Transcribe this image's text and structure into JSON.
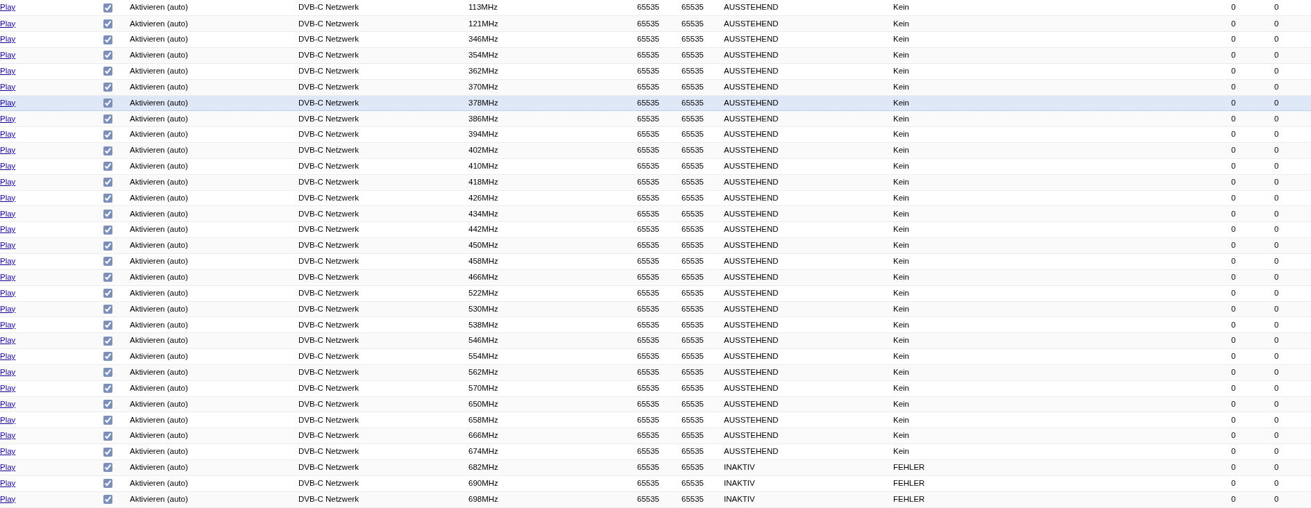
{
  "rows": [
    {
      "link": "Play",
      "enabled": true,
      "mode": "Aktivieren (auto)",
      "network": "DVB-C Netzwerk",
      "frequency": "113MHz",
      "column_6": "65535",
      "column_7": "65535",
      "status": "AUSSTEHEND",
      "result": "Kein",
      "column_10": "0",
      "column_11": "0",
      "selected": false
    },
    {
      "link": "Play",
      "enabled": true,
      "mode": "Aktivieren (auto)",
      "network": "DVB-C Netzwerk",
      "frequency": "121MHz",
      "column_6": "65535",
      "column_7": "65535",
      "status": "AUSSTEHEND",
      "result": "Kein",
      "column_10": "0",
      "column_11": "0",
      "selected": false
    },
    {
      "link": "Play",
      "enabled": true,
      "mode": "Aktivieren (auto)",
      "network": "DVB-C Netzwerk",
      "frequency": "346MHz",
      "column_6": "65535",
      "column_7": "65535",
      "status": "AUSSTEHEND",
      "result": "Kein",
      "column_10": "0",
      "column_11": "0",
      "selected": false
    },
    {
      "link": "Play",
      "enabled": true,
      "mode": "Aktivieren (auto)",
      "network": "DVB-C Netzwerk",
      "frequency": "354MHz",
      "column_6": "65535",
      "column_7": "65535",
      "status": "AUSSTEHEND",
      "result": "Kein",
      "column_10": "0",
      "column_11": "0",
      "selected": false
    },
    {
      "link": "Play",
      "enabled": true,
      "mode": "Aktivieren (auto)",
      "network": "DVB-C Netzwerk",
      "frequency": "362MHz",
      "column_6": "65535",
      "column_7": "65535",
      "status": "AUSSTEHEND",
      "result": "Kein",
      "column_10": "0",
      "column_11": "0",
      "selected": false
    },
    {
      "link": "Play",
      "enabled": true,
      "mode": "Aktivieren (auto)",
      "network": "DVB-C Netzwerk",
      "frequency": "370MHz",
      "column_6": "65535",
      "column_7": "65535",
      "status": "AUSSTEHEND",
      "result": "Kein",
      "column_10": "0",
      "column_11": "0",
      "selected": false
    },
    {
      "link": "Play",
      "enabled": true,
      "mode": "Aktivieren (auto)",
      "network": "DVB-C Netzwerk",
      "frequency": "378MHz",
      "column_6": "65535",
      "column_7": "65535",
      "status": "AUSSTEHEND",
      "result": "Kein",
      "column_10": "0",
      "column_11": "0",
      "selected": true
    },
    {
      "link": "Play",
      "enabled": true,
      "mode": "Aktivieren (auto)",
      "network": "DVB-C Netzwerk",
      "frequency": "386MHz",
      "column_6": "65535",
      "column_7": "65535",
      "status": "AUSSTEHEND",
      "result": "Kein",
      "column_10": "0",
      "column_11": "0",
      "selected": false
    },
    {
      "link": "Play",
      "enabled": true,
      "mode": "Aktivieren (auto)",
      "network": "DVB-C Netzwerk",
      "frequency": "394MHz",
      "column_6": "65535",
      "column_7": "65535",
      "status": "AUSSTEHEND",
      "result": "Kein",
      "column_10": "0",
      "column_11": "0",
      "selected": false
    },
    {
      "link": "Play",
      "enabled": true,
      "mode": "Aktivieren (auto)",
      "network": "DVB-C Netzwerk",
      "frequency": "402MHz",
      "column_6": "65535",
      "column_7": "65535",
      "status": "AUSSTEHEND",
      "result": "Kein",
      "column_10": "0",
      "column_11": "0",
      "selected": false
    },
    {
      "link": "Play",
      "enabled": true,
      "mode": "Aktivieren (auto)",
      "network": "DVB-C Netzwerk",
      "frequency": "410MHz",
      "column_6": "65535",
      "column_7": "65535",
      "status": "AUSSTEHEND",
      "result": "Kein",
      "column_10": "0",
      "column_11": "0",
      "selected": false
    },
    {
      "link": "Play",
      "enabled": true,
      "mode": "Aktivieren (auto)",
      "network": "DVB-C Netzwerk",
      "frequency": "418MHz",
      "column_6": "65535",
      "column_7": "65535",
      "status": "AUSSTEHEND",
      "result": "Kein",
      "column_10": "0",
      "column_11": "0",
      "selected": false
    },
    {
      "link": "Play",
      "enabled": true,
      "mode": "Aktivieren (auto)",
      "network": "DVB-C Netzwerk",
      "frequency": "426MHz",
      "column_6": "65535",
      "column_7": "65535",
      "status": "AUSSTEHEND",
      "result": "Kein",
      "column_10": "0",
      "column_11": "0",
      "selected": false
    },
    {
      "link": "Play",
      "enabled": true,
      "mode": "Aktivieren (auto)",
      "network": "DVB-C Netzwerk",
      "frequency": "434MHz",
      "column_6": "65535",
      "column_7": "65535",
      "status": "AUSSTEHEND",
      "result": "Kein",
      "column_10": "0",
      "column_11": "0",
      "selected": false
    },
    {
      "link": "Play",
      "enabled": true,
      "mode": "Aktivieren (auto)",
      "network": "DVB-C Netzwerk",
      "frequency": "442MHz",
      "column_6": "65535",
      "column_7": "65535",
      "status": "AUSSTEHEND",
      "result": "Kein",
      "column_10": "0",
      "column_11": "0",
      "selected": false
    },
    {
      "link": "Play",
      "enabled": true,
      "mode": "Aktivieren (auto)",
      "network": "DVB-C Netzwerk",
      "frequency": "450MHz",
      "column_6": "65535",
      "column_7": "65535",
      "status": "AUSSTEHEND",
      "result": "Kein",
      "column_10": "0",
      "column_11": "0",
      "selected": false
    },
    {
      "link": "Play",
      "enabled": true,
      "mode": "Aktivieren (auto)",
      "network": "DVB-C Netzwerk",
      "frequency": "458MHz",
      "column_6": "65535",
      "column_7": "65535",
      "status": "AUSSTEHEND",
      "result": "Kein",
      "column_10": "0",
      "column_11": "0",
      "selected": false
    },
    {
      "link": "Play",
      "enabled": true,
      "mode": "Aktivieren (auto)",
      "network": "DVB-C Netzwerk",
      "frequency": "466MHz",
      "column_6": "65535",
      "column_7": "65535",
      "status": "AUSSTEHEND",
      "result": "Kein",
      "column_10": "0",
      "column_11": "0",
      "selected": false
    },
    {
      "link": "Play",
      "enabled": true,
      "mode": "Aktivieren (auto)",
      "network": "DVB-C Netzwerk",
      "frequency": "522MHz",
      "column_6": "65535",
      "column_7": "65535",
      "status": "AUSSTEHEND",
      "result": "Kein",
      "column_10": "0",
      "column_11": "0",
      "selected": false
    },
    {
      "link": "Play",
      "enabled": true,
      "mode": "Aktivieren (auto)",
      "network": "DVB-C Netzwerk",
      "frequency": "530MHz",
      "column_6": "65535",
      "column_7": "65535",
      "status": "AUSSTEHEND",
      "result": "Kein",
      "column_10": "0",
      "column_11": "0",
      "selected": false
    },
    {
      "link": "Play",
      "enabled": true,
      "mode": "Aktivieren (auto)",
      "network": "DVB-C Netzwerk",
      "frequency": "538MHz",
      "column_6": "65535",
      "column_7": "65535",
      "status": "AUSSTEHEND",
      "result": "Kein",
      "column_10": "0",
      "column_11": "0",
      "selected": false
    },
    {
      "link": "Play",
      "enabled": true,
      "mode": "Aktivieren (auto)",
      "network": "DVB-C Netzwerk",
      "frequency": "546MHz",
      "column_6": "65535",
      "column_7": "65535",
      "status": "AUSSTEHEND",
      "result": "Kein",
      "column_10": "0",
      "column_11": "0",
      "selected": false
    },
    {
      "link": "Play",
      "enabled": true,
      "mode": "Aktivieren (auto)",
      "network": "DVB-C Netzwerk",
      "frequency": "554MHz",
      "column_6": "65535",
      "column_7": "65535",
      "status": "AUSSTEHEND",
      "result": "Kein",
      "column_10": "0",
      "column_11": "0",
      "selected": false
    },
    {
      "link": "Play",
      "enabled": true,
      "mode": "Aktivieren (auto)",
      "network": "DVB-C Netzwerk",
      "frequency": "562MHz",
      "column_6": "65535",
      "column_7": "65535",
      "status": "AUSSTEHEND",
      "result": "Kein",
      "column_10": "0",
      "column_11": "0",
      "selected": false
    },
    {
      "link": "Play",
      "enabled": true,
      "mode": "Aktivieren (auto)",
      "network": "DVB-C Netzwerk",
      "frequency": "570MHz",
      "column_6": "65535",
      "column_7": "65535",
      "status": "AUSSTEHEND",
      "result": "Kein",
      "column_10": "0",
      "column_11": "0",
      "selected": false
    },
    {
      "link": "Play",
      "enabled": true,
      "mode": "Aktivieren (auto)",
      "network": "DVB-C Netzwerk",
      "frequency": "650MHz",
      "column_6": "65535",
      "column_7": "65535",
      "status": "AUSSTEHEND",
      "result": "Kein",
      "column_10": "0",
      "column_11": "0",
      "selected": false
    },
    {
      "link": "Play",
      "enabled": true,
      "mode": "Aktivieren (auto)",
      "network": "DVB-C Netzwerk",
      "frequency": "658MHz",
      "column_6": "65535",
      "column_7": "65535",
      "status": "AUSSTEHEND",
      "result": "Kein",
      "column_10": "0",
      "column_11": "0",
      "selected": false
    },
    {
      "link": "Play",
      "enabled": true,
      "mode": "Aktivieren (auto)",
      "network": "DVB-C Netzwerk",
      "frequency": "666MHz",
      "column_6": "65535",
      "column_7": "65535",
      "status": "AUSSTEHEND",
      "result": "Kein",
      "column_10": "0",
      "column_11": "0",
      "selected": false
    },
    {
      "link": "Play",
      "enabled": true,
      "mode": "Aktivieren (auto)",
      "network": "DVB-C Netzwerk",
      "frequency": "674MHz",
      "column_6": "65535",
      "column_7": "65535",
      "status": "AUSSTEHEND",
      "result": "Kein",
      "column_10": "0",
      "column_11": "0",
      "selected": false
    },
    {
      "link": "Play",
      "enabled": true,
      "mode": "Aktivieren (auto)",
      "network": "DVB-C Netzwerk",
      "frequency": "682MHz",
      "column_6": "65535",
      "column_7": "65535",
      "status": "INAKTIV",
      "result": "FEHLER",
      "column_10": "0",
      "column_11": "0",
      "selected": false
    },
    {
      "link": "Play",
      "enabled": true,
      "mode": "Aktivieren (auto)",
      "network": "DVB-C Netzwerk",
      "frequency": "690MHz",
      "column_6": "65535",
      "column_7": "65535",
      "status": "INAKTIV",
      "result": "FEHLER",
      "column_10": "0",
      "column_11": "0",
      "selected": false
    },
    {
      "link": "Play",
      "enabled": true,
      "mode": "Aktivieren (auto)",
      "network": "DVB-C Netzwerk",
      "frequency": "698MHz",
      "column_6": "65535",
      "column_7": "65535",
      "status": "INAKTIV",
      "result": "FEHLER",
      "column_10": "0",
      "column_11": "0",
      "selected": false
    }
  ]
}
